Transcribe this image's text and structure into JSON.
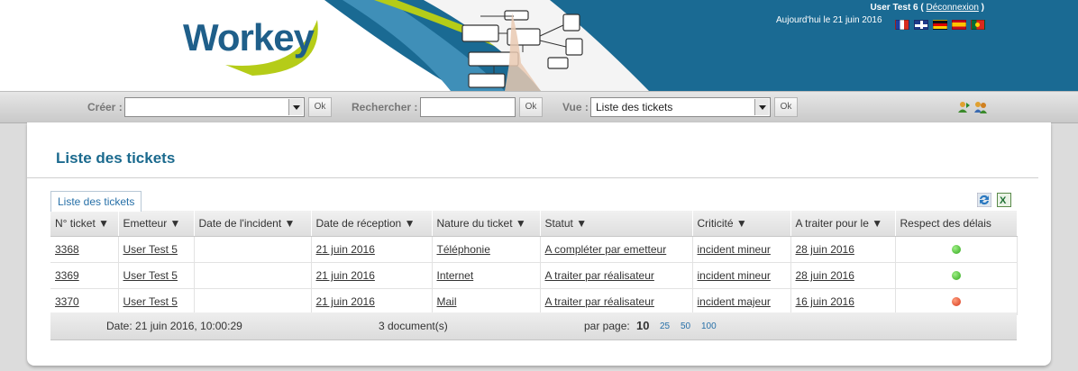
{
  "header": {
    "logo_text": "Workey",
    "user_name": "User Test 6",
    "logout_label": "Déconnexion",
    "date_text": "Aujourd'hui le 21 juin 2016",
    "languages": [
      "french-flag",
      "english-flag",
      "german-flag",
      "spanish-flag",
      "portuguese-flag"
    ]
  },
  "toolbar": {
    "create_label": "Créer :",
    "create_value": "",
    "ok_label": "Ok",
    "search_label": "Rechercher :",
    "search_value": "",
    "view_label": "Vue :",
    "view_value": "Liste des tickets"
  },
  "main": {
    "title": "Liste des tickets",
    "tab_label": "Liste des tickets",
    "columns": [
      "N° ticket ▼",
      "Emetteur ▼",
      "Date de l'incident ▼",
      "Date de réception ▼",
      "Nature du ticket ▼",
      "Statut ▼",
      "Criticité ▼",
      "A traiter pour le ▼",
      "Respect des délais"
    ],
    "rows": [
      {
        "num": "3368",
        "emetteur": "User Test 5",
        "date_incident": "",
        "date_reception": "21 juin 2016",
        "nature": "Téléphonie",
        "statut": "A compléter par emetteur",
        "criticite": "incident mineur",
        "a_traiter": "28 juin 2016",
        "delai": "green"
      },
      {
        "num": "3369",
        "emetteur": "User Test 5",
        "date_incident": "",
        "date_reception": "21 juin 2016",
        "nature": "Internet",
        "statut": "A traiter par réalisateur",
        "criticite": "incident mineur",
        "a_traiter": "28 juin 2016",
        "delai": "green"
      },
      {
        "num": "3370",
        "emetteur": "User Test 5",
        "date_incident": "",
        "date_reception": "21 juin 2016",
        "nature": "Mail",
        "statut": "A traiter par réalisateur",
        "criticite": "incident majeur",
        "a_traiter": "16 juin 2016",
        "delai": "red"
      }
    ],
    "footer": {
      "date_text": "Date: 21 juin 2016, 10:00:29",
      "count_text": "3 document(s)",
      "per_page_label": "par page:",
      "per_page_current": "10",
      "per_page_options": [
        "25",
        "50",
        "100"
      ]
    }
  },
  "colors": {
    "brand_blue": "#1f5f8a",
    "banner_blue": "#1a6a93",
    "accent_green": "#b5cc18",
    "title_blue": "#1b6a8e"
  }
}
